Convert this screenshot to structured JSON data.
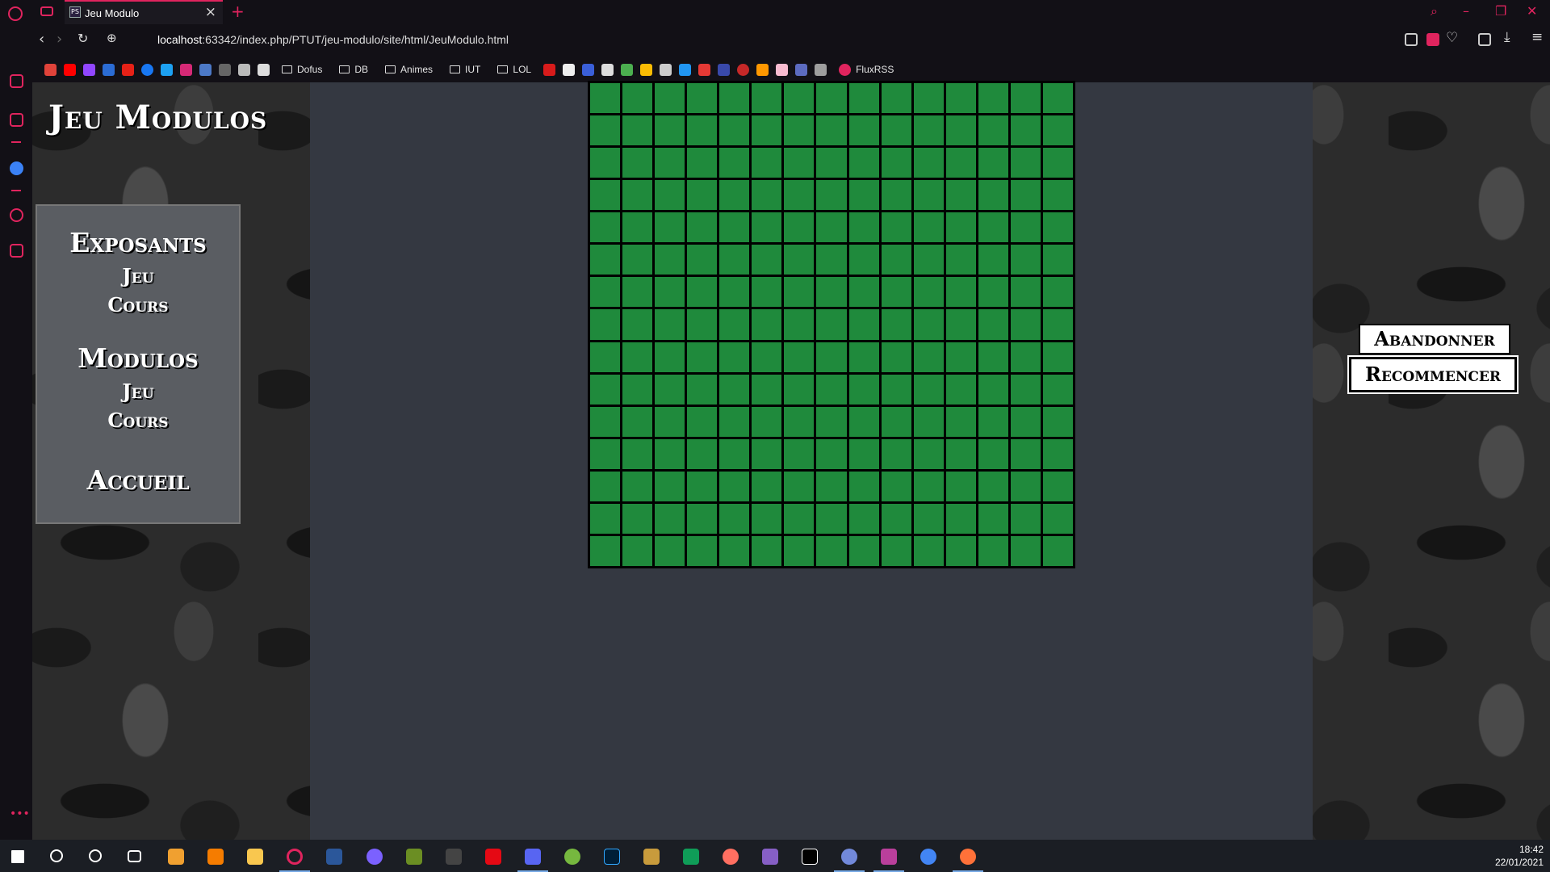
{
  "browser": {
    "tab_title": "Jeu Modulo",
    "tab_favicon_text": "PS",
    "url_host": "localhost",
    "url_rest": ":63342/index.php/PTUT/jeu-modulo/site/html/JeuModulo.html",
    "bookmarks": {
      "folders": [
        "Dofus",
        "DB",
        "Animes",
        "IUT",
        "LOL"
      ],
      "fluxrss_label": "FluxRSS"
    },
    "accent_color": "#e0245e"
  },
  "page": {
    "site_title": "Jeu Modulos",
    "menu": {
      "exposants_heading": "Exposants",
      "exposants_jeu": "Jeu",
      "exposants_cours": "Cours",
      "modulos_heading": "Modulos",
      "modulos_jeu": "Jeu",
      "modulos_cours": "Cours",
      "accueil": "Accueil"
    },
    "board": {
      "rows": 15,
      "cols": 15,
      "cell_color": "#1f8a3c"
    },
    "buttons": {
      "abandon": "Abandonner",
      "restart": "Recommencer"
    }
  },
  "taskbar": {
    "time": "18:42",
    "date": "22/01/2021"
  }
}
